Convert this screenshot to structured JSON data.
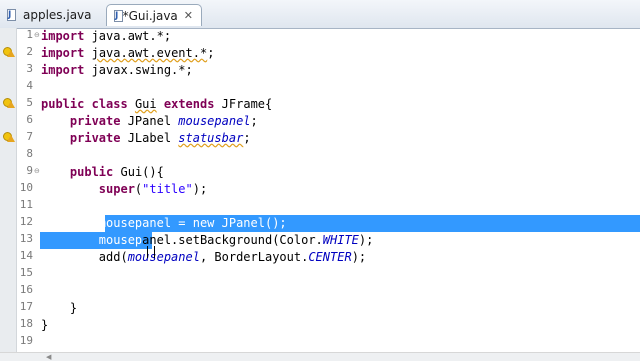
{
  "tabs": [
    {
      "label": "apples.java",
      "active": false
    },
    {
      "label": "*Gui.java",
      "active": true
    }
  ],
  "editor": {
    "lines": [
      {
        "num": "1",
        "text": "import java.awt.*;",
        "fold": "minus",
        "marker": ""
      },
      {
        "num": "2",
        "text": "import java.awt.event.*;",
        "fold": "",
        "marker": "warning"
      },
      {
        "num": "3",
        "text": "import javax.swing.*;",
        "fold": "",
        "marker": ""
      },
      {
        "num": "4",
        "text": "",
        "fold": "",
        "marker": ""
      },
      {
        "num": "5",
        "text": "public class Gui extends JFrame{",
        "fold": "",
        "marker": "warning"
      },
      {
        "num": "6",
        "text": "    private JPanel mousepanel;",
        "fold": "",
        "marker": ""
      },
      {
        "num": "7",
        "text": "    private JLabel statusbar;",
        "fold": "",
        "marker": "warning"
      },
      {
        "num": "8",
        "text": "",
        "fold": "",
        "marker": ""
      },
      {
        "num": "9",
        "text": "    public Gui(){",
        "fold": "minus",
        "marker": ""
      },
      {
        "num": "10",
        "text": "        super(\"title\");",
        "fold": "",
        "marker": ""
      },
      {
        "num": "11",
        "text": "",
        "fold": "",
        "marker": ""
      },
      {
        "num": "12",
        "text": "        mousepanel = new JPanel();",
        "fold": "",
        "marker": ""
      },
      {
        "num": "13",
        "text": "        mousepanel.setBackground(Color.WHITE);",
        "fold": "",
        "marker": ""
      },
      {
        "num": "14",
        "text": "        add(mousepanel, BorderLayout.CENTER);",
        "fold": "",
        "marker": ""
      },
      {
        "num": "15",
        "text": "",
        "fold": "",
        "marker": ""
      },
      {
        "num": "16",
        "text": "",
        "fold": "",
        "marker": ""
      },
      {
        "num": "17",
        "text": "    }",
        "fold": "",
        "marker": ""
      },
      {
        "num": "18",
        "text": "}",
        "fold": "",
        "marker": ""
      },
      {
        "num": "19",
        "text": "",
        "fold": "",
        "marker": ""
      }
    ]
  },
  "colors": {
    "keyword": "#7f0055",
    "string": "#2a00ff",
    "field": "#0000c0",
    "selection": "#3399ff"
  }
}
